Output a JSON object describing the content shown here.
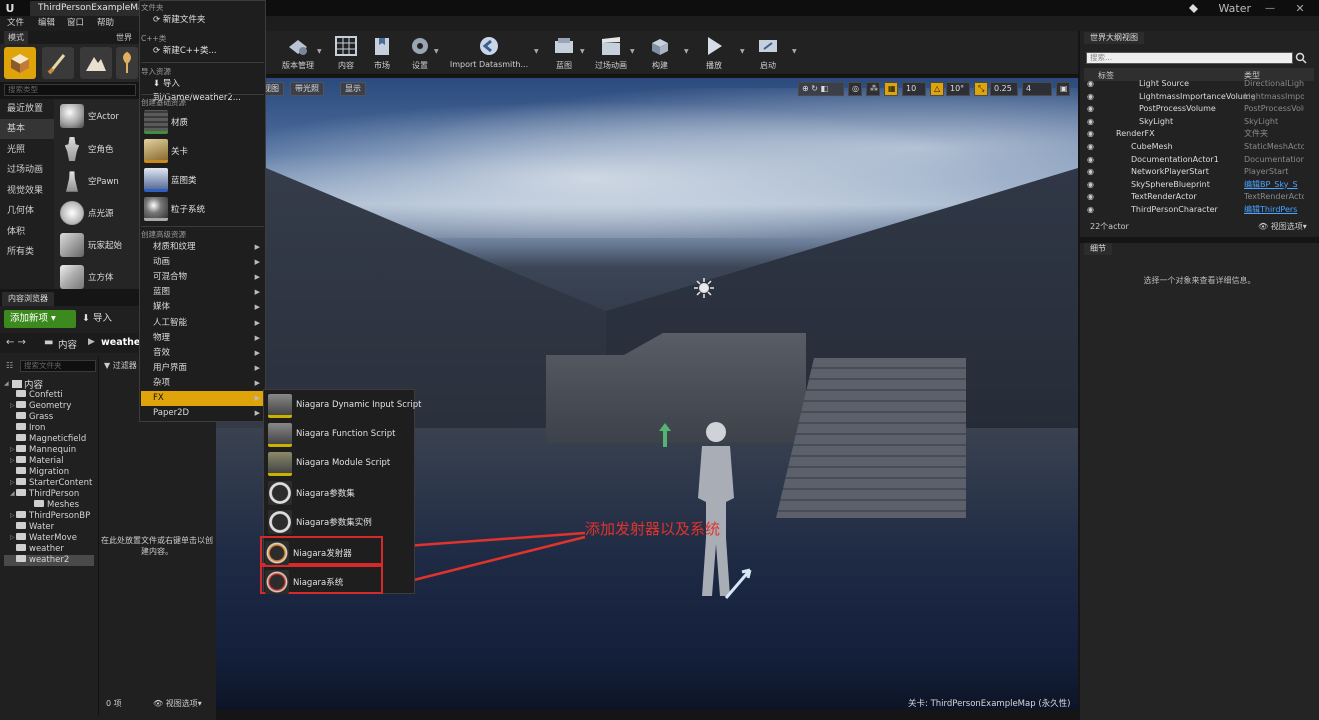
{
  "titlebar": {
    "doc_tab": "ThirdPersonExampleMap*",
    "project": "Water"
  },
  "menu": [
    "文件",
    "编辑",
    "窗口",
    "帮助"
  ],
  "modes": {
    "tabs": [
      "模式",
      "世界"
    ],
    "search_placeholder": "搜索类型",
    "categories": [
      "最近放置",
      "基本",
      "光照",
      "过场动画",
      "视觉效果",
      "几何体",
      "体积",
      "所有类"
    ],
    "items": [
      "空Actor",
      "空角色",
      "空Pawn",
      "点光源",
      "玩家起始",
      "立方体"
    ]
  },
  "create_menu": {
    "h_folder": "文件夹",
    "new_folder": "新建文件夹",
    "h_cpp": "C++类",
    "new_cpp": "新建C++类...",
    "h_import": "导入资源",
    "import_to": "导入到/Game/weather2...",
    "h_basic": "创建基础资源",
    "basic": [
      "材质",
      "关卡",
      "蓝图类",
      "粒子系统"
    ],
    "h_advanced": "创建高级资源",
    "advanced": [
      "材质和纹理",
      "动画",
      "可混合物",
      "蓝图",
      "媒体",
      "人工智能",
      "物理",
      "音效",
      "用户界面",
      "杂项",
      "FX",
      "Paper2D"
    ]
  },
  "fx_menu": [
    "Niagara Dynamic Input Script",
    "Niagara Function Script",
    "Niagara Module Script",
    "Niagara参数集",
    "Niagara参数集实例",
    "Niagara发射器",
    "Niagara系统"
  ],
  "toolbar": [
    "版本管理",
    "内容",
    "市场",
    "设置",
    "Import Datasmith...",
    "蓝图",
    "过场动画",
    "构建",
    "播放",
    "启动"
  ],
  "viewport": {
    "buttons": [
      "视图",
      "带光照",
      "显示"
    ],
    "snap": {
      "grid": "10",
      "rot": "10°",
      "scale": "0.25",
      "cam": "4"
    },
    "map_label": "关卡:  ThirdPersonExampleMap (永久性)",
    "annotation": "添加发射器以及系统"
  },
  "content_browser": {
    "tab": "内容浏览器",
    "add_new": "添加新项",
    "import": "导入",
    "path": [
      "内容",
      "weather"
    ],
    "search_placeholder": "搜索文件夹",
    "filter": "过滤器",
    "root": "内容",
    "folders": [
      "Confetti",
      "Geometry",
      "Grass",
      "Iron",
      "Magneticfield",
      "Mannequin",
      "Material",
      "Migration",
      "StarterContent",
      "ThirdPerson",
      "Meshes",
      "ThirdPersonBP",
      "Water",
      "WaterMove",
      "weather",
      "weather2"
    ],
    "empty_hint": "在此处放置文件或右键单击以创建内容。",
    "count": "0 项",
    "view_options": "视图选项"
  },
  "outliner": {
    "tab": "世界大纲视图",
    "search_placeholder": "搜索...",
    "col_label": "标签",
    "col_type": "类型",
    "rows": [
      {
        "name": "Light Source",
        "type": "DirectionalLight"
      },
      {
        "name": "LightmassImportanceVolume",
        "type": "LightmassImpor"
      },
      {
        "name": "PostProcessVolume",
        "type": "PostProcessVolu"
      },
      {
        "name": "SkyLight",
        "type": "SkyLight"
      },
      {
        "name": "RenderFX",
        "type": "文件夹"
      },
      {
        "name": "CubeMesh",
        "type": "StaticMeshActo"
      },
      {
        "name": "DocumentationActor1",
        "type": "Documentation"
      },
      {
        "name": "NetworkPlayerStart",
        "type": "PlayerStart"
      },
      {
        "name": "SkySphereBlueprint",
        "type": "编辑BP_Sky_S"
      },
      {
        "name": "TextRenderActor",
        "type": "TextRenderActo"
      },
      {
        "name": "ThirdPersonCharacter",
        "type": "编辑ThirdPers"
      }
    ],
    "count": "22个actor",
    "view_options": "视图选项"
  },
  "details": {
    "tab": "细节",
    "hint": "选择一个对象来查看详细信息。"
  }
}
